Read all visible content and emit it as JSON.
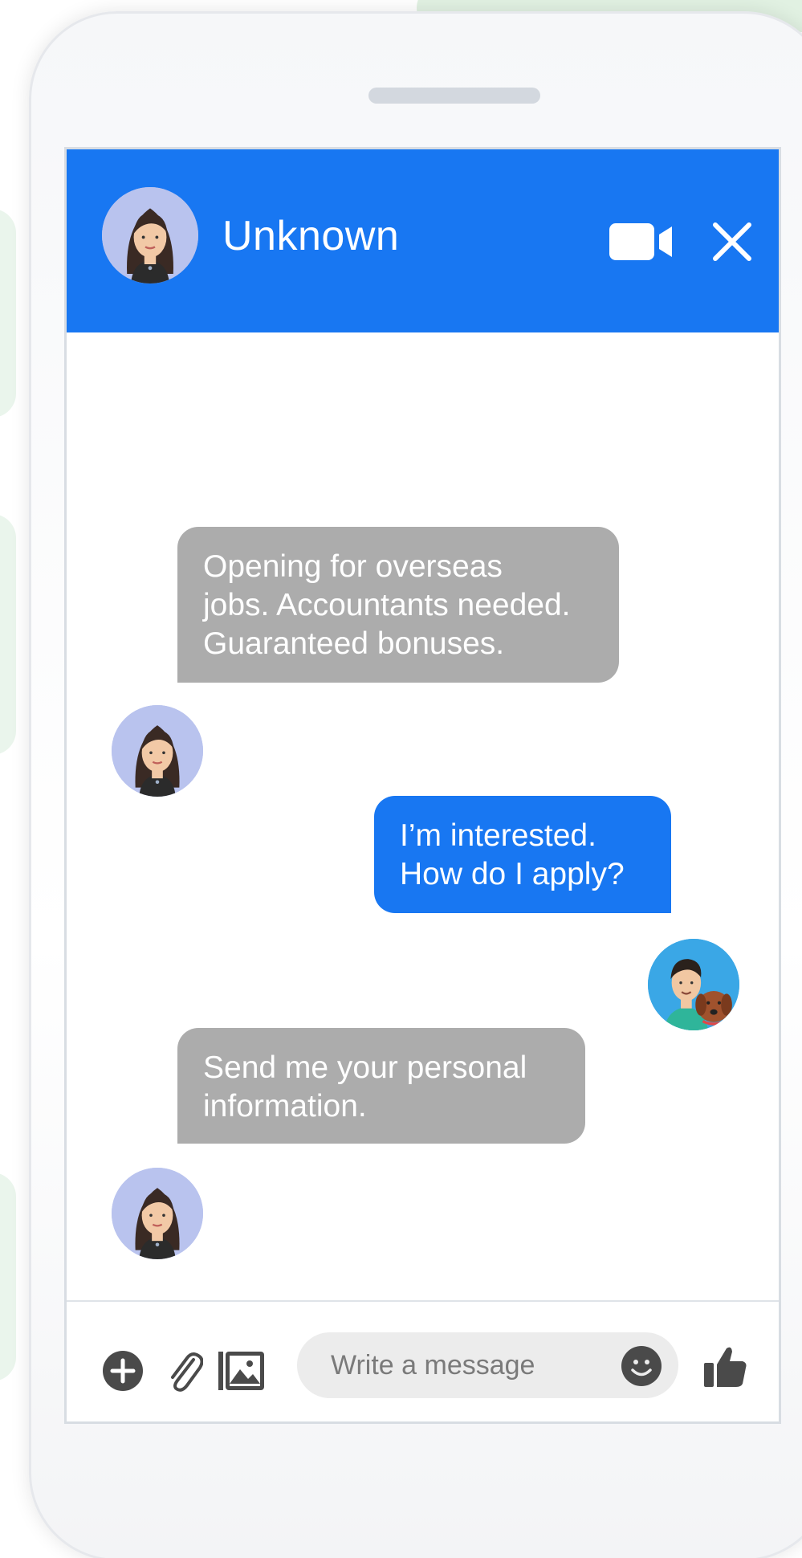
{
  "chat": {
    "contact_name": "Unknown"
  },
  "messages": [
    {
      "direction": "incoming",
      "lines": [
        "Opening for overseas",
        "jobs. Accountants needed.",
        "Guaranteed bonuses."
      ]
    },
    {
      "direction": "outgoing",
      "lines": [
        "I’m interested.",
        "How do I apply?"
      ]
    },
    {
      "direction": "incoming",
      "lines": [
        "Send me your personal",
        "information."
      ]
    }
  ],
  "composer": {
    "placeholder": "Write a message"
  },
  "icons": {
    "video": "video-camera-icon",
    "close": "close-icon",
    "add": "plus-circle-icon",
    "attach": "paperclip-icon",
    "image": "image-icon",
    "emoji": "smiley-icon",
    "like": "thumbs-up-icon"
  },
  "colors": {
    "header": "#1877f2",
    "outgoing_bubble": "#1877f2",
    "incoming_bubble": "#acacac",
    "icon_gray": "#555555"
  }
}
